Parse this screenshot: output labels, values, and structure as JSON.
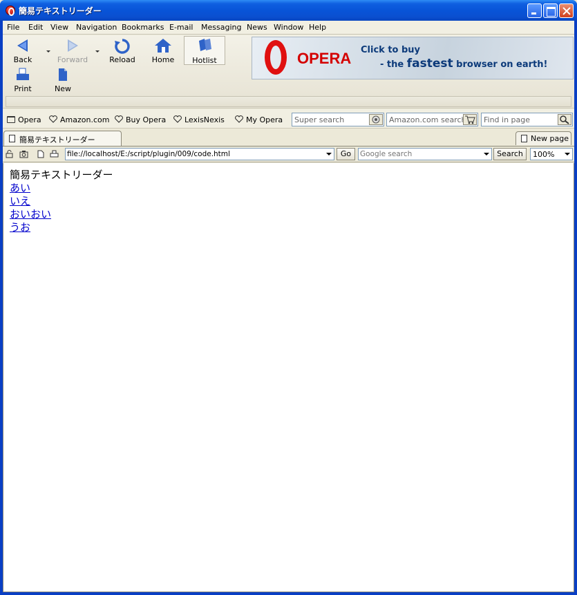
{
  "window": {
    "title": "簡易テキストリーダー"
  },
  "menu": [
    "File",
    "Edit",
    "View",
    "Navigation",
    "Bookmarks",
    "E-mail",
    "Messaging",
    "News",
    "Window",
    "Help"
  ],
  "toolbar": {
    "back": "Back",
    "forward": "Forward",
    "reload": "Reload",
    "home": "Home",
    "hotlist": "Hotlist",
    "print": "Print",
    "new": "New"
  },
  "banner": {
    "brand": "OPERA",
    "line1": "Click to buy",
    "line2_prefix": "- the",
    "line2_bold": "fastest",
    "line2_suffix": "browser on earth!"
  },
  "personal_bar": {
    "items": [
      "Opera",
      "Amazon.com",
      "Buy Opera",
      "LexisNexis",
      "My Opera"
    ],
    "super_search_placeholder": "Super search",
    "amazon_search_placeholder": "Amazon.com search",
    "find_in_page_placeholder": "Find in page"
  },
  "tabs": {
    "active_title": "簡易テキストリーダー",
    "new_page": "New page"
  },
  "address_bar": {
    "url": "file://localhost/E:/script/plugin/009/code.html",
    "go": "Go",
    "google_placeholder": "Google search",
    "search": "Search",
    "zoom": "100%"
  },
  "page": {
    "heading": "簡易テキストリーダー",
    "links": [
      "あい",
      "いえ",
      "おいおい",
      "うお"
    ]
  },
  "colors": {
    "titlebar": "#0854d8",
    "link": "#0000cc",
    "opera_red": "#d40000"
  }
}
